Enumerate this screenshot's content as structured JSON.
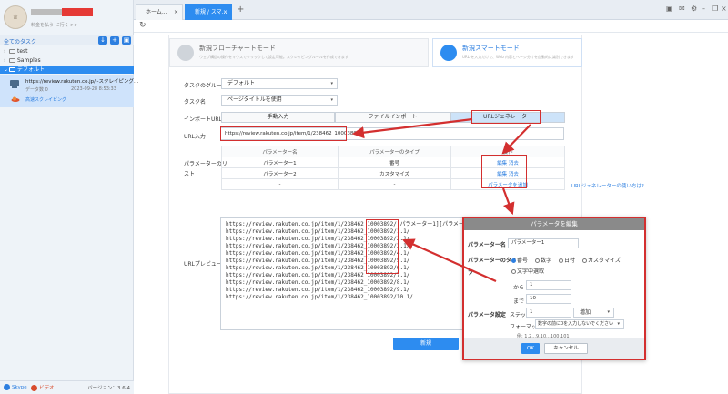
{
  "sidebar": {
    "user_sub": "料金を払う に行く >>",
    "all_tasks": "全てのタスク",
    "tree": [
      "test",
      "Samples",
      "デフォルト"
    ],
    "task": {
      "title": "https://review.rakuten.co.jp/i-スクレイピング...",
      "count_label": "データ数",
      "count": "0",
      "date": "2023-09-28 8:53:33",
      "action": "高速スクレイピング"
    },
    "footer": {
      "skype": "Skype",
      "video": "ビデオ",
      "version": "バージョン：3.6.4"
    }
  },
  "tabs": [
    {
      "label": "ホーム...",
      "active": false
    },
    {
      "label": "新規 / スマ...",
      "active": true
    }
  ],
  "modes": [
    {
      "title": "新規フローチャートモード",
      "desc": "ウェブ構造の操作をマウスでクリックして設定可能。スクレイピングルールを作成できます",
      "active": false
    },
    {
      "title": "新規スマートモード",
      "desc": "URL を入力だけで、Web 内容とページ分けを自動的に識別できます",
      "active": true
    }
  ],
  "form": {
    "group_label": "タスクのグループ",
    "group_value": "デフォルト",
    "name_label": "タスク名",
    "name_value": "ページタイトルを使用",
    "import_label": "インポートURL",
    "import_options": [
      "手動入力",
      "ファイルインポート",
      "URLジェネレーター"
    ],
    "url_label": "URL入力",
    "url_value": "https://review.rakuten.co.jp/item/1/238462_10003892/",
    "param_label_1": "パラメーターのリ",
    "param_label_2": "スト",
    "preview_label": "URLプレビュー",
    "help_link": "URLジェネレーターの使い方は?",
    "new_button": "新規"
  },
  "param_table": {
    "headers": [
      "パラメーター名",
      "パラメーターのタイプ",
      "操作"
    ],
    "rows": [
      {
        "name": "パラメーター1",
        "type": "番号",
        "edit": "編集",
        "delete": "消去"
      },
      {
        "name": "パラメーター2",
        "type": "カスタマイズ",
        "edit": "編集",
        "delete": "消去"
      },
      {
        "name": "-",
        "type": "-",
        "edit": "",
        "delete": ""
      }
    ],
    "add_param": "パラメータを追加"
  },
  "preview_lines": [
    "https://review.rakuten.co.jp/item/1/238462_10003892/[パラメーター1][パラメーター2]",
    "https://review.rakuten.co.jp/item/1/238462_10003892/1.1/",
    "https://review.rakuten.co.jp/item/1/238462_10003892/2.1/",
    "https://review.rakuten.co.jp/item/1/238462_10003892/3.1/",
    "https://review.rakuten.co.jp/item/1/238462_10003892/4.1/",
    "https://review.rakuten.co.jp/item/1/238462_10003892/5.1/",
    "https://review.rakuten.co.jp/item/1/238462_10003892/6.1/",
    "https://review.rakuten.co.jp/item/1/238462_10003892/7.1/",
    "https://review.rakuten.co.jp/item/1/238462_10003892/8.1/",
    "https://review.rakuten.co.jp/item/1/238462_10003892/9.1/",
    "https://review.rakuten.co.jp/item/1/238462_10003892/10.1/"
  ],
  "dialog": {
    "title": "パラメータを編集",
    "name_label": "パラメーター名",
    "name_value": "パラメーター1",
    "type_label_1": "パラメーターのタイ",
    "type_label_2": "プ",
    "type_options": [
      "番号",
      "数字",
      "日付",
      "カスタマイズ",
      "文字中選取"
    ],
    "type_selected": "番号",
    "from_label": "から",
    "from_value": "1",
    "to_label": "まで",
    "to_value": "10",
    "setting_label": "パラメータ設定",
    "step_label": "ステップ",
    "step_value": "1",
    "order_value": "増加",
    "format_label": "フォーマット",
    "format_value": "数字の前に0を入力しないでください",
    "example": "例: 1,2...9,10...100,101",
    "ok": "OK",
    "cancel": "キャンセル"
  }
}
